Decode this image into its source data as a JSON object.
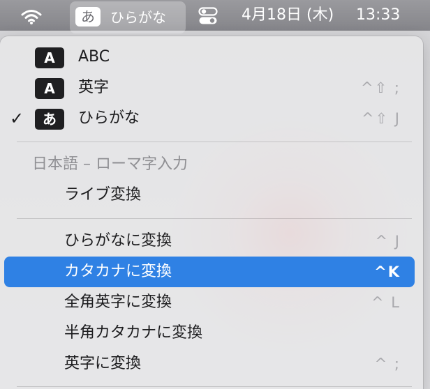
{
  "menubar": {
    "ime_badge": "あ",
    "ime_label": "ひらがな",
    "date": "4月18日 (木)",
    "time": "13:33",
    "icons": [
      "wifi-icon",
      "control-center-icon"
    ]
  },
  "menu": {
    "input_sources": [
      {
        "badge": "A",
        "label": "ABC",
        "shortcut": "",
        "checked": false
      },
      {
        "badge": "A",
        "label": "英字",
        "shortcut": "^⇧ ;",
        "checked": false
      },
      {
        "badge": "あ",
        "label": "ひらがな",
        "shortcut": "^⇧ J",
        "checked": true,
        "check": "✓"
      }
    ],
    "section_header": "日本語 – ローマ字入力",
    "live_conversion": "ライブ変換",
    "conversions": [
      {
        "label": "ひらがなに変換",
        "shortcut": "^ J",
        "selected": false
      },
      {
        "label": "カタカナに変換",
        "shortcut": "^K",
        "selected": true
      },
      {
        "label": "全角英字に変換",
        "shortcut": "^ L",
        "selected": false
      },
      {
        "label": "半角カタカナに変換",
        "shortcut": "",
        "selected": false
      },
      {
        "label": "英字に変換",
        "shortcut": "^ ;",
        "selected": false
      }
    ]
  },
  "colors": {
    "selection": "#2f81e4",
    "badge_bg": "#1f1f21",
    "shortcut_text": "#a8a8ac",
    "header_text": "#8f8f93"
  }
}
